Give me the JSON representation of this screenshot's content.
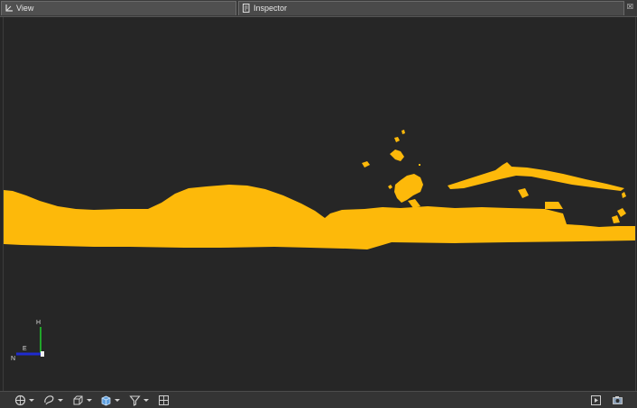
{
  "tabs": [
    {
      "label": "View",
      "icon": "view-axis-icon",
      "active": true
    },
    {
      "label": "Inspector",
      "icon": "inspector-doc-icon",
      "active": false
    }
  ],
  "gizmo": {
    "up_label": "H",
    "east_label": "E",
    "north_label": "N"
  },
  "colors": {
    "background": "#262626",
    "point_cloud": "#fdb90a",
    "axis_up": "#21a52a",
    "axis_north": "#1f2bd0"
  },
  "toolbar": {
    "left": [
      {
        "icon": "render-mode-icon",
        "dropdown": true
      },
      {
        "icon": "selection-lasso-icon",
        "dropdown": true
      },
      {
        "icon": "bounding-box-icon",
        "dropdown": true
      },
      {
        "icon": "cube-view-icon",
        "dropdown": true
      },
      {
        "icon": "filter-funnel-icon",
        "dropdown": true
      },
      {
        "icon": "grid-icon",
        "dropdown": false
      }
    ],
    "right": [
      {
        "icon": "play-icon"
      },
      {
        "icon": "screenshot-icon"
      }
    ]
  }
}
